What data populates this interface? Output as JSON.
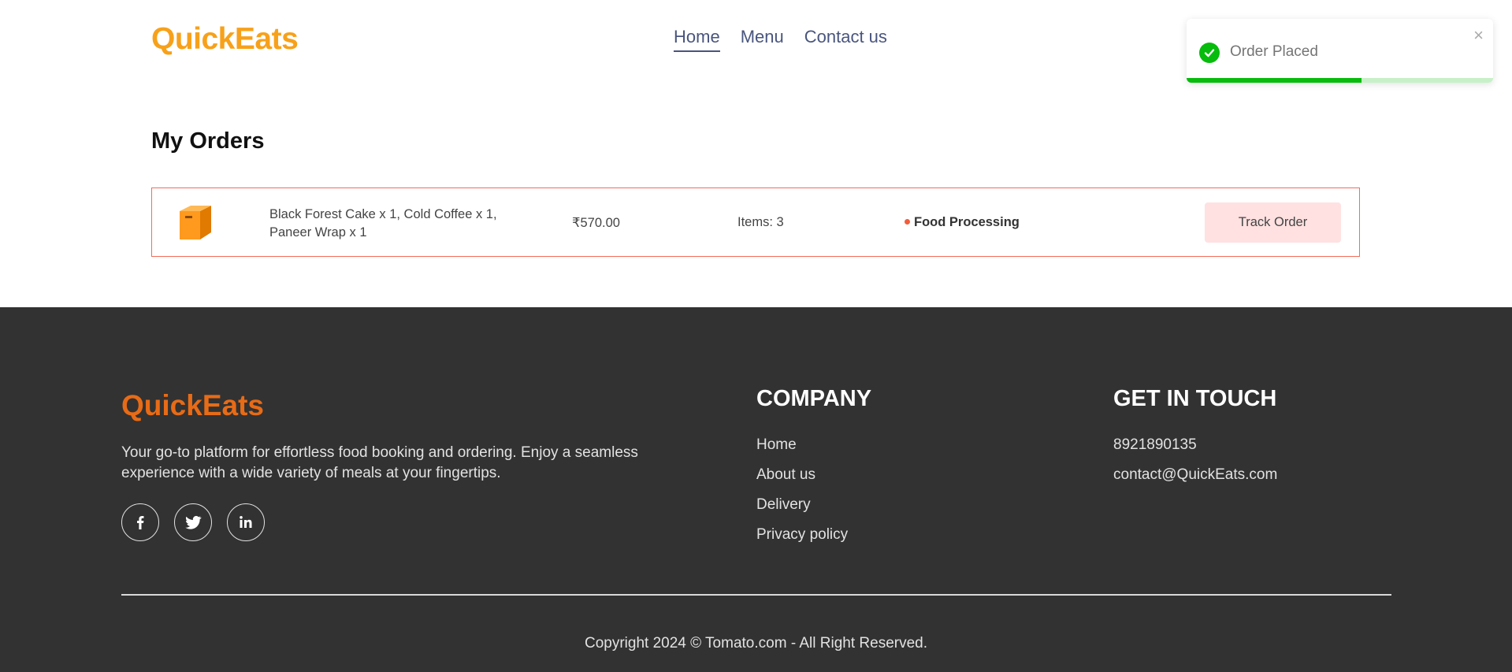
{
  "header": {
    "logo": "QuickEats",
    "nav": [
      {
        "label": "Home",
        "active": true
      },
      {
        "label": "Menu",
        "active": false
      },
      {
        "label": "Contact us",
        "active": false
      }
    ]
  },
  "toast": {
    "message": "Order Placed",
    "close_icon": "close-icon",
    "progress_fraction": 0.57,
    "colors": {
      "success": "#07bc0c",
      "progress_track": "#c7f0c8"
    }
  },
  "orders": {
    "title": "My Orders",
    "items": [
      {
        "icon": "parcel-icon",
        "items_text": "Black Forest Cake x 1, Cold Coffee x 1, Paneer Wrap x 1",
        "amount": "₹570.00",
        "count": "Items: 3",
        "status": "Food Processing",
        "action": "Track Order"
      }
    ]
  },
  "footer": {
    "logo": "QuickEats",
    "description": "Your go-to platform for effortless food booking and ordering. Enjoy a seamless experience with a wide variety of meals at your fingertips.",
    "socials": [
      "facebook-icon",
      "twitter-icon",
      "linkedin-icon"
    ],
    "company": {
      "heading": "COMPANY",
      "links": [
        "Home",
        "About us",
        "Delivery",
        "Privacy policy"
      ]
    },
    "contact": {
      "heading": "GET IN TOUCH",
      "phone": "8921890135",
      "email": "contact@QuickEats.com"
    },
    "copyright": "Copyright 2024 © Tomato.com - All Right Reserved."
  },
  "colors": {
    "brand_orange": "#f7a11a",
    "footer_logo": "#e86b16",
    "nav_text": "#49557e",
    "order_border": "#f26d5b",
    "track_button_bg": "#ffe1e1",
    "footer_bg": "#323232"
  }
}
